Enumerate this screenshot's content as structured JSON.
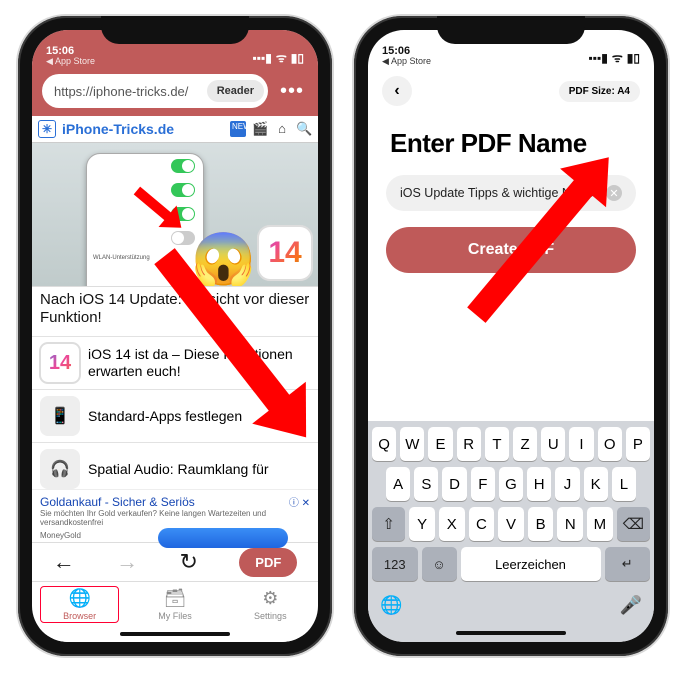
{
  "status": {
    "time": "15:06",
    "back_label": "App Store",
    "signal": "▪▪▪▮",
    "wifi": "ᯤ",
    "battery": "▮▯"
  },
  "left": {
    "url": "https://iphone-tricks.de/",
    "reader_label": "Reader",
    "site_name": "iPhone-Tricks.de",
    "site_badge": "NEW",
    "hero_badge": "14",
    "headline": "Nach iOS 14 Update: Vorsicht vor dieser Funktion!",
    "item1": "iOS 14 ist da – Diese Funktionen erwarten euch!",
    "item2": "Standard-Apps festlegen",
    "item3": "Spatial Audio: Raumklang für",
    "ad_title": "Goldankauf - Sicher & Seriös",
    "ad_sub": "Sie möchten Ihr Gold verkaufen? Keine langen Wartezeiten und versandkostenfrei",
    "ad_brand": "MoneyGold",
    "ad_mark": "ⓘ ✕",
    "nav": {
      "back": "←",
      "fwd": "→",
      "reload": "↻",
      "pdf": "PDF"
    },
    "tabs": {
      "browser": "Browser",
      "files": "My Files",
      "settings": "Settings"
    }
  },
  "right": {
    "size_label": "PDF Size: A4",
    "title": "Enter PDF Name",
    "input_value": "iOS Update Tipps & wichtige  News",
    "create_label": "Create PDF",
    "keyboard": {
      "row1": [
        "Q",
        "W",
        "E",
        "R",
        "T",
        "Z",
        "U",
        "I",
        "O",
        "P"
      ],
      "row2": [
        "A",
        "S",
        "D",
        "F",
        "G",
        "H",
        "J",
        "K",
        "L"
      ],
      "row3_shift": "⇧",
      "row3": [
        "Y",
        "X",
        "C",
        "V",
        "B",
        "N",
        "M"
      ],
      "row3_del": "⌫",
      "row4_123": "123",
      "row4_emoji": "☺",
      "row4_space": "Leerzeichen",
      "row4_return": "↵"
    }
  }
}
